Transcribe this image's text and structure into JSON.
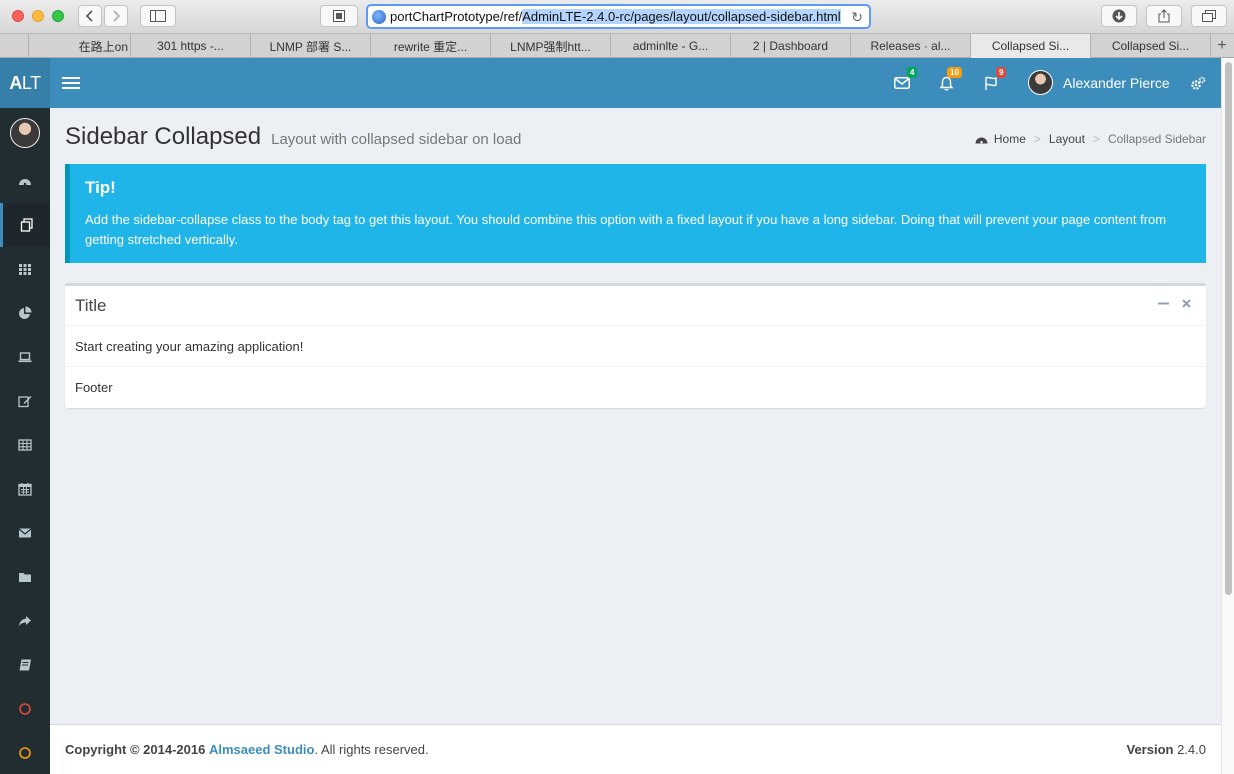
{
  "browser": {
    "url_prefix": "portChartPrototype/ref/",
    "url_selected": "AdminLTE-2.4.0-rc/pages/layout/collapsed-sidebar.html",
    "tabs": [
      {
        "label": ""
      },
      {
        "label": "在路上on"
      },
      {
        "label": "301 https -..."
      },
      {
        "label": "LNMP 部署 S..."
      },
      {
        "label": "rewrite 重定..."
      },
      {
        "label": "LNMP强制htt..."
      },
      {
        "label": "adminlte - G..."
      },
      {
        "label": "2 | Dashboard"
      },
      {
        "label": "Releases · al..."
      },
      {
        "label": "Collapsed Si..."
      },
      {
        "label": "Collapsed Si..."
      }
    ]
  },
  "header": {
    "logo_bold": "A",
    "logo_rest": "LT",
    "messages_count": "4",
    "notifications_count": "10",
    "tasks_count": "9",
    "user_name": "Alexander Pierce"
  },
  "page": {
    "title": "Sidebar Collapsed",
    "subtitle": "Layout with collapsed sidebar on load"
  },
  "breadcrumb": {
    "home": "Home",
    "layout": "Layout",
    "current": "Collapsed Sidebar"
  },
  "callout": {
    "title": "Tip!",
    "text": "Add the sidebar-collapse class to the body tag to get this layout. You should combine this option with a fixed layout if you have a long sidebar. Doing that will prevent your page content from getting stretched vertically."
  },
  "box": {
    "title": "Title",
    "body": "Start creating your amazing application!",
    "footer": "Footer"
  },
  "footer": {
    "copyright_prefix": "Copyright © 2014-2016",
    "company": "Almsaeed Studio",
    "rights": ". All rights reserved.",
    "version_label": "Version",
    "version_value": "2.4.0"
  },
  "sidebar_icons": [
    "dashboard-icon",
    "files-icon",
    "grid-icon",
    "pie-chart-icon",
    "laptop-icon",
    "edit-icon",
    "table-icon",
    "calendar-icon",
    "envelope-icon",
    "folder-icon",
    "share-icon",
    "book-icon",
    "circle-red-icon",
    "circle-yellow-icon"
  ],
  "colors": {
    "header": "#3c8dbc",
    "sidebar": "#222d32",
    "callout": "#00c0ef",
    "badge_messages": "#00a65a",
    "badge_notifications": "#f39c12",
    "badge_tasks": "#dd4b39"
  }
}
